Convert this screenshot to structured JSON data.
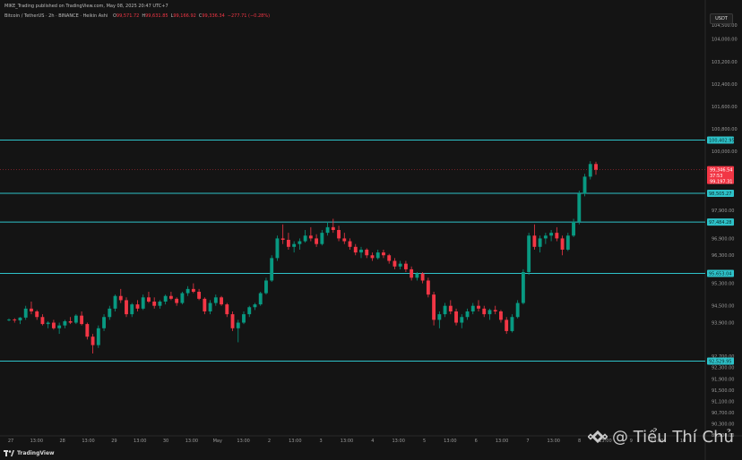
{
  "header": {
    "published": "MIKE_Trading published on TradingView.com, May 08, 2025 20:47 UTC+7",
    "symbol": "Bitcoin / TetherUS · 2h · BINANCE · Heikin Ashi",
    "ohlc": [
      {
        "k": "O",
        "v": "99,571.72"
      },
      {
        "k": "H",
        "v": "99,631.85"
      },
      {
        "k": "L",
        "v": "99,166.92"
      },
      {
        "k": "C",
        "v": "99,336.34"
      },
      {
        "k": "",
        "v": "−277.71 (−0.28%)"
      }
    ]
  },
  "currency": "USDT",
  "price_scale": [
    "104,500.00",
    "104,000.00",
    "103,200.00",
    "102,400.00",
    "101,600.00",
    "100,800.00",
    "100,000.00",
    "98,400.00",
    "97,900.00",
    "96,900.00",
    "96,300.00",
    "95,300.00",
    "94,500.00",
    "93,900.00",
    "92,700.00",
    "92,300.00",
    "91,900.00",
    "91,500.00",
    "91,100.00",
    "90,700.00",
    "90,300.00",
    "89,900.00"
  ],
  "price_labels": {
    "last": {
      "value": "99,346.54",
      "countdown": "37:53",
      "prev": "99,197.31",
      "color": "#f23645"
    },
    "lines": [
      "100,402.95",
      "98,505.27",
      "97,484.28",
      "95,653.04",
      "92,529.95"
    ]
  },
  "horizontal_lines": [
    100402.95,
    98505.27,
    97484.28,
    95653.04,
    92529.95
  ],
  "line_color": "#2ec2c9",
  "time_axis": [
    "27",
    "13:00",
    "28",
    "13:00",
    "29",
    "13:00",
    "30",
    "13:00",
    "May",
    "13:00",
    "2",
    "13:00",
    "3",
    "13:00",
    "4",
    "13:00",
    "5",
    "13:00",
    "6",
    "13:00",
    "7",
    "13:00",
    "8",
    "13:00",
    "9",
    "13:00",
    "10"
  ],
  "branding": {
    "tradingview": "TradingView",
    "watermark": "@ Tiểu Thí Chủ"
  },
  "colors": {
    "up": "#089981",
    "down": "#f23645",
    "background": "#141414"
  },
  "chart_data": {
    "type": "candlestick",
    "interval": "2h",
    "chart_style": "Heikin Ashi",
    "ylim": [
      89900,
      104500
    ],
    "candles": [
      [
        94000,
        94050,
        93950,
        94010
      ],
      [
        94010,
        94060,
        93900,
        93980
      ],
      [
        93980,
        94100,
        93850,
        94080
      ],
      [
        94080,
        94500,
        94000,
        94400
      ],
      [
        94400,
        94650,
        94200,
        94300
      ],
      [
        94300,
        94350,
        94000,
        94100
      ],
      [
        94100,
        94200,
        93800,
        93850
      ],
      [
        93850,
        93950,
        93700,
        93900
      ],
      [
        93900,
        94000,
        93650,
        93700
      ],
      [
        93700,
        93900,
        93500,
        93800
      ],
      [
        93800,
        94000,
        93700,
        93950
      ],
      [
        93950,
        94100,
        93850,
        93900
      ],
      [
        93900,
        94200,
        93850,
        94150
      ],
      [
        94150,
        94300,
        93800,
        93850
      ],
      [
        93850,
        93900,
        93300,
        93400
      ],
      [
        93400,
        93500,
        92800,
        93100
      ],
      [
        93100,
        93800,
        93000,
        93700
      ],
      [
        93700,
        94200,
        93600,
        94100
      ],
      [
        94100,
        94500,
        94000,
        94400
      ],
      [
        94400,
        94900,
        94300,
        94850
      ],
      [
        94850,
        95100,
        94600,
        94700
      ],
      [
        94700,
        94800,
        94100,
        94200
      ],
      [
        94200,
        94600,
        94100,
        94550
      ],
      [
        94550,
        94700,
        94300,
        94400
      ],
      [
        94400,
        94900,
        94350,
        94800
      ],
      [
        94800,
        95000,
        94600,
        94650
      ],
      [
        94650,
        94800,
        94400,
        94500
      ],
      [
        94500,
        94700,
        94400,
        94650
      ],
      [
        94650,
        94900,
        94550,
        94850
      ],
      [
        94850,
        95000,
        94700,
        94750
      ],
      [
        94750,
        94800,
        94500,
        94600
      ],
      [
        94600,
        95000,
        94550,
        94950
      ],
      [
        94950,
        95200,
        94850,
        95100
      ],
      [
        95100,
        95300,
        94950,
        95000
      ],
      [
        95000,
        95100,
        94700,
        94750
      ],
      [
        94750,
        94800,
        94200,
        94300
      ],
      [
        94300,
        94700,
        94200,
        94600
      ],
      [
        94600,
        94900,
        94500,
        94800
      ],
      [
        94800,
        94850,
        94500,
        94550
      ],
      [
        94550,
        94600,
        94100,
        94200
      ],
      [
        94200,
        94300,
        93600,
        93700
      ],
      [
        93700,
        94000,
        93200,
        93900
      ],
      [
        93900,
        94300,
        93850,
        94200
      ],
      [
        94200,
        94500,
        94100,
        94450
      ],
      [
        94450,
        94600,
        94350,
        94550
      ],
      [
        94550,
        95000,
        94500,
        94950
      ],
      [
        94950,
        95500,
        94900,
        95400
      ],
      [
        95400,
        96300,
        95350,
        96200
      ],
      [
        96200,
        97000,
        96100,
        96900
      ],
      [
        96900,
        97400,
        96700,
        96850
      ],
      [
        96850,
        97100,
        96500,
        96600
      ],
      [
        96600,
        96800,
        96400,
        96700
      ],
      [
        96700,
        96900,
        96500,
        96800
      ],
      [
        96800,
        97200,
        96750,
        97000
      ],
      [
        97000,
        97300,
        96800,
        96900
      ],
      [
        96900,
        97050,
        96600,
        96700
      ],
      [
        96700,
        97200,
        96650,
        97100
      ],
      [
        97100,
        97500,
        97000,
        97300
      ],
      [
        97300,
        97600,
        97100,
        97200
      ],
      [
        97200,
        97350,
        96800,
        96900
      ],
      [
        96900,
        97100,
        96700,
        96800
      ],
      [
        96800,
        96900,
        96500,
        96600
      ],
      [
        96600,
        96700,
        96300,
        96400
      ],
      [
        96400,
        96600,
        96200,
        96500
      ],
      [
        96500,
        96550,
        96200,
        96300
      ],
      [
        96300,
        96400,
        96100,
        96200
      ],
      [
        96200,
        96500,
        96150,
        96400
      ],
      [
        96400,
        96500,
        96200,
        96300
      ],
      [
        96300,
        96350,
        96000,
        96100
      ],
      [
        96100,
        96200,
        95800,
        95900
      ],
      [
        95900,
        96100,
        95800,
        96000
      ],
      [
        96000,
        96100,
        95700,
        95800
      ],
      [
        95800,
        95900,
        95400,
        95500
      ],
      [
        95500,
        95700,
        95400,
        95650
      ],
      [
        95650,
        95700,
        95300,
        95400
      ],
      [
        95400,
        95500,
        94800,
        94900
      ],
      [
        94900,
        95000,
        93800,
        94000
      ],
      [
        94000,
        94300,
        93700,
        94200
      ],
      [
        94200,
        94600,
        94100,
        94500
      ],
      [
        94500,
        94700,
        94200,
        94300
      ],
      [
        94300,
        94400,
        93800,
        93900
      ],
      [
        93900,
        94200,
        93700,
        94100
      ],
      [
        94100,
        94400,
        94000,
        94300
      ],
      [
        94300,
        94600,
        94200,
        94500
      ],
      [
        94500,
        94700,
        94300,
        94400
      ],
      [
        94400,
        94500,
        94100,
        94200
      ],
      [
        94200,
        94400,
        94000,
        94350
      ],
      [
        94350,
        94500,
        94200,
        94300
      ],
      [
        94300,
        94350,
        93900,
        94000
      ],
      [
        94000,
        94100,
        93500,
        93600
      ],
      [
        93600,
        94200,
        93550,
        94100
      ],
      [
        94100,
        94700,
        94050,
        94600
      ],
      [
        94600,
        95800,
        94550,
        95700
      ],
      [
        95700,
        97100,
        95600,
        97000
      ],
      [
        97000,
        97400,
        96500,
        96600
      ],
      [
        96600,
        97000,
        96400,
        96900
      ],
      [
        96900,
        97100,
        96700,
        97000
      ],
      [
        97000,
        97200,
        96800,
        97100
      ],
      [
        97100,
        97300,
        96800,
        96900
      ],
      [
        96900,
        97000,
        96300,
        96500
      ],
      [
        96500,
        97100,
        96450,
        97000
      ],
      [
        97000,
        97600,
        96950,
        97500
      ],
      [
        97500,
        98600,
        97400,
        98500
      ],
      [
        98500,
        99200,
        98400,
        99100
      ],
      [
        99100,
        99650,
        99000,
        99550
      ],
      [
        99550,
        99630,
        99170,
        99346
      ]
    ]
  }
}
